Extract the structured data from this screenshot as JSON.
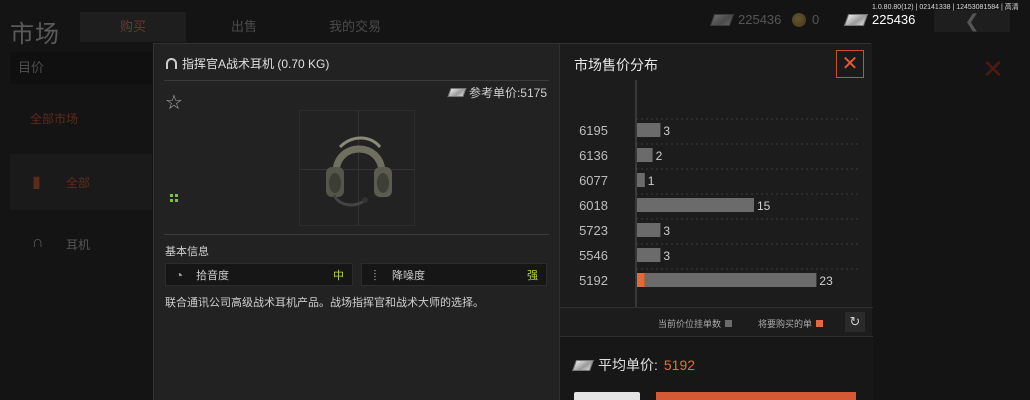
{
  "background": {
    "title": "市场",
    "tabs": [
      "购买",
      "出售",
      "我的交易"
    ],
    "search_placeholder": "目价",
    "side_orange": "全部市场",
    "side_items": [
      {
        "icon": "item-category-icon",
        "label": "全部"
      },
      {
        "icon": "headphone-icon",
        "label": "耳机"
      }
    ]
  },
  "currency": {
    "cash1": "225436",
    "coin": "0",
    "cash2": "225436",
    "version": "1.0.80.80(12) | 02141338 | 12453081584 | 高清"
  },
  "item": {
    "title": "指挥官A战术耳机 (0.70 KG)",
    "ref_price_label": "参考单价:5175",
    "section": "基本信息",
    "attributes": [
      {
        "icon": "ear-icon",
        "label": "拾音度",
        "value": "中"
      },
      {
        "icon": "noise-icon",
        "label": "降噪度",
        "value": "强"
      }
    ],
    "description": "联合通讯公司高级战术耳机产品。战场指挥官和战术大师的选择。"
  },
  "market": {
    "title": "市场售价分布",
    "legend_current": "当前价位挂单数",
    "legend_buy": "将要购买的单",
    "avg_label": "平均单价:",
    "avg_value": "5192"
  },
  "chart_data": {
    "type": "bar",
    "orientation": "horizontal",
    "categories": [
      "6195",
      "6136",
      "6077",
      "6018",
      "5723",
      "5546",
      "5192"
    ],
    "series": [
      {
        "name": "当前价位挂单数",
        "values": [
          3,
          2,
          1,
          15,
          3,
          3,
          22
        ]
      },
      {
        "name": "将要购买的单",
        "values": [
          0,
          0,
          0,
          0,
          0,
          0,
          1
        ]
      }
    ],
    "colors": {
      "current": "#6b6b6b",
      "buy": "#e06a3a"
    },
    "xlim": [
      0,
      25
    ],
    "grid": true
  }
}
